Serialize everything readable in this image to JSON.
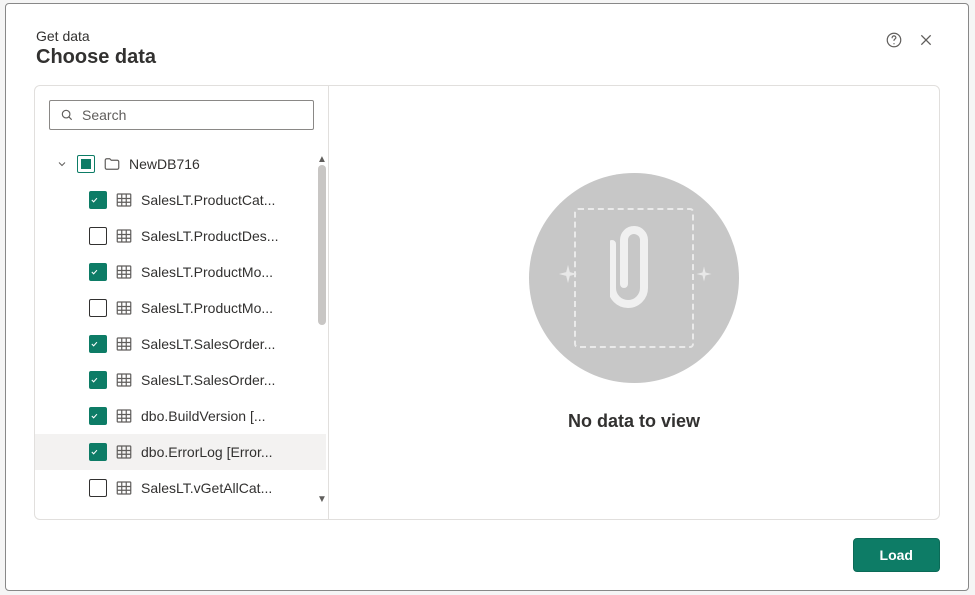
{
  "header": {
    "subtitle": "Get data",
    "title": "Choose data"
  },
  "search": {
    "placeholder": "Search",
    "value": ""
  },
  "tree": {
    "database": {
      "name": "NewDB716",
      "checkbox_state": "mixed",
      "expanded": true
    },
    "items": [
      {
        "label": "SalesLT.ProductCat...",
        "checked": true
      },
      {
        "label": "SalesLT.ProductDes...",
        "checked": false
      },
      {
        "label": "SalesLT.ProductMo...",
        "checked": true
      },
      {
        "label": "SalesLT.ProductMo...",
        "checked": false
      },
      {
        "label": "SalesLT.SalesOrder...",
        "checked": true
      },
      {
        "label": "SalesLT.SalesOrder...",
        "checked": true
      },
      {
        "label": "dbo.BuildVersion [...",
        "checked": true
      },
      {
        "label": "dbo.ErrorLog [Error...",
        "checked": true,
        "hovered": true
      },
      {
        "label": "SalesLT.vGetAllCat...",
        "checked": false
      }
    ]
  },
  "preview": {
    "empty_text": "No data to view"
  },
  "footer": {
    "load_label": "Load"
  },
  "colors": {
    "accent": "#0d7c66"
  }
}
